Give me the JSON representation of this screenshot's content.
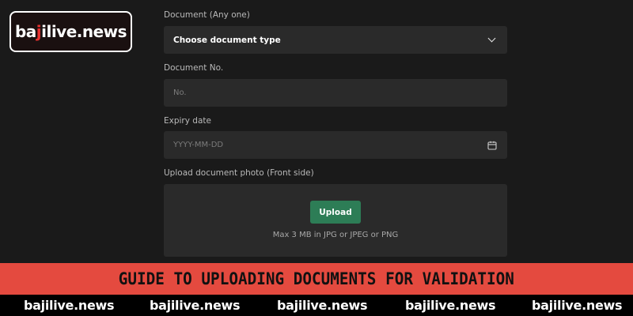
{
  "brand": {
    "logo_prefix": "ba",
    "logo_accent": "j",
    "logo_suffix": "ilive.news",
    "accent_color": "#e8312f"
  },
  "form": {
    "document_label": "Document (Any one)",
    "document_select_value": "Choose document type",
    "document_no_label": "Document No.",
    "document_no_placeholder": "No.",
    "expiry_label": "Expiry date",
    "expiry_placeholder": "YYYY-MM-DD",
    "upload_label": "Upload document photo (Front side)",
    "upload_button": "Upload",
    "upload_hint": "Max 3 MB in JPG or JPEG or PNG",
    "button_color": "#2d7d56"
  },
  "banner": {
    "title": "GUIDE TO UPLOADING DOCUMENTS FOR VALIDATION",
    "color": "#e44a3f"
  },
  "footer": {
    "items": [
      "bajilive.news",
      "bajilive.news",
      "bajilive.news",
      "bajilive.news",
      "bajilive.news"
    ]
  },
  "icons": [
    "chevron-down-icon",
    "calendar-icon"
  ]
}
